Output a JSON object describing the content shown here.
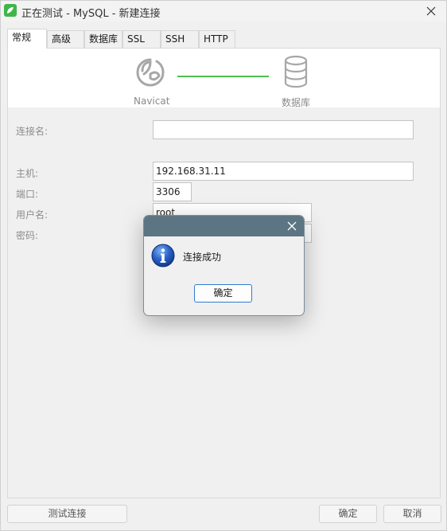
{
  "window": {
    "title": "正在测试 - MySQL - 新建连接"
  },
  "tabs": [
    {
      "label": "常规",
      "active": true
    },
    {
      "label": "高级",
      "active": false
    },
    {
      "label": "数据库",
      "active": false
    },
    {
      "label": "SSL",
      "active": false
    },
    {
      "label": "SSH",
      "active": false
    },
    {
      "label": "HTTP",
      "active": false
    }
  ],
  "diagram": {
    "client_label": "Navicat",
    "server_label": "数据库",
    "link_color": "#4cc04f"
  },
  "form": {
    "connection_name": {
      "label": "连接名:",
      "value": ""
    },
    "host": {
      "label": "主机:",
      "value": "192.168.31.11"
    },
    "port": {
      "label": "端口:",
      "value": "3306"
    },
    "username": {
      "label": "用户名:",
      "value": "root"
    },
    "password": {
      "label": "密码:",
      "value": ""
    }
  },
  "buttons": {
    "test_connection": "测试连接",
    "ok": "确定",
    "cancel": "取消"
  },
  "modal": {
    "message": "连接成功",
    "ok_label": "确定",
    "icon": "info-icon",
    "titlebar_color": "#5c7582"
  }
}
